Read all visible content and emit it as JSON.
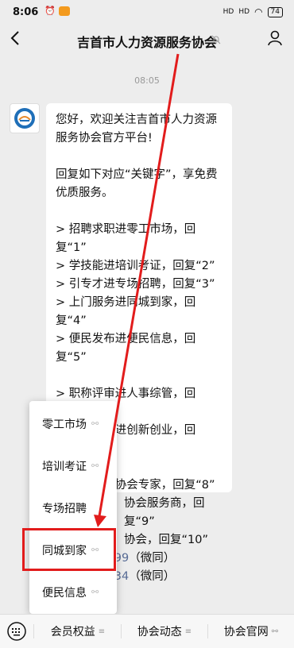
{
  "status": {
    "time": "8:06",
    "battery": "74",
    "signal1": "HD",
    "signal2": "HD"
  },
  "header": {
    "title": "吉首市人力资源服务协会"
  },
  "chat": {
    "timestamp": "08:05",
    "message": {
      "lines": [
        "您好，欢迎关注吉首市人力资源",
        "服务协会官方平台!",
        "",
        "回复如下对应“关键字”，享免费",
        "优质服务。",
        "",
        "> 招聘求职进零工市场，回复“1”",
        "> 学技能进培训考证，回复“2”",
        "> 引专才进专场招聘，回复“3”",
        "> 上门服务进同城到家，回复“4”",
        "> 便民发布进便民信息，回复“5”",
        "",
        "> 职称评审进人事综管，回复“6”",
        "> 创业贷款进创新创业，回复“7”",
        "",
        "> 申请成为协会专家，回复“8”",
        "协会服务商，回复“9”",
        "协会，回复“10”"
      ],
      "phone1": "3974303099",
      "phone1_suffix": "（微同）",
      "phone2": "3807431234",
      "phone2_suffix": "（微同）"
    }
  },
  "popup": {
    "items": [
      {
        "label": "零工市场"
      },
      {
        "label": "培训考证"
      },
      {
        "label": "专场招聘"
      },
      {
        "label": "同城到家"
      },
      {
        "label": "便民信息"
      }
    ],
    "link_icon": "link-icon"
  },
  "bottom": {
    "tabs": [
      {
        "label": "会员权益",
        "icon": "menu-icon"
      },
      {
        "label": "协会动态",
        "icon": "menu-icon"
      },
      {
        "label": "协会官网",
        "icon": "link-icon"
      }
    ]
  },
  "colors": {
    "highlight": "#e21c1c",
    "link": "#576b95",
    "background": "#ededed"
  }
}
